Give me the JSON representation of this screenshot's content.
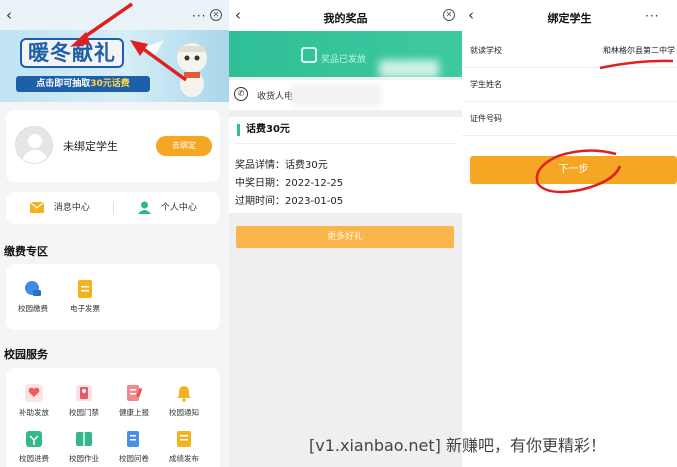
{
  "panel1": {
    "banner": {
      "title": "暖冬献礼",
      "strip_prefix": "点击即可抽取",
      "strip_highlight": "30元话费"
    },
    "profile": {
      "status": "未绑定学生",
      "bind_button": "去绑定"
    },
    "quick": {
      "messages": "消息中心",
      "personal": "个人中心"
    },
    "payment_section": {
      "title": "缴费专区",
      "items": [
        "校园缴费",
        "电子发票"
      ]
    },
    "services_section": {
      "title": "校园服务",
      "items": [
        "补助发放",
        "校园门禁",
        "健康上报",
        "校园通知",
        "校园进费",
        "校园作业",
        "校园问卷",
        "成绩发布"
      ]
    }
  },
  "panel2": {
    "title": "我的奖品",
    "status_text": "奖品已发放",
    "recipient_label": "收货人电",
    "prize_title": "话费30元",
    "details": [
      "奖品详情：话费30元",
      "中奖日期：2022-12-25",
      "过期时间：2023-01-05"
    ],
    "more_button": "更多好礼"
  },
  "panel3": {
    "title": "绑定学生",
    "fields": [
      {
        "label": "就读学校",
        "value": "和林格尔县第二中学"
      },
      {
        "label": "学生姓名",
        "value": ""
      },
      {
        "label": "证件号码",
        "value": ""
      }
    ],
    "next_button": "下一步"
  },
  "watermark": "[v1.xianbao.net] 新赚吧，有你更精彩！",
  "colors": {
    "accent_orange": "#f5a623",
    "green": "#2fbf96",
    "banner_blue": "#1d5fa8",
    "annotation_red": "#e02020"
  }
}
